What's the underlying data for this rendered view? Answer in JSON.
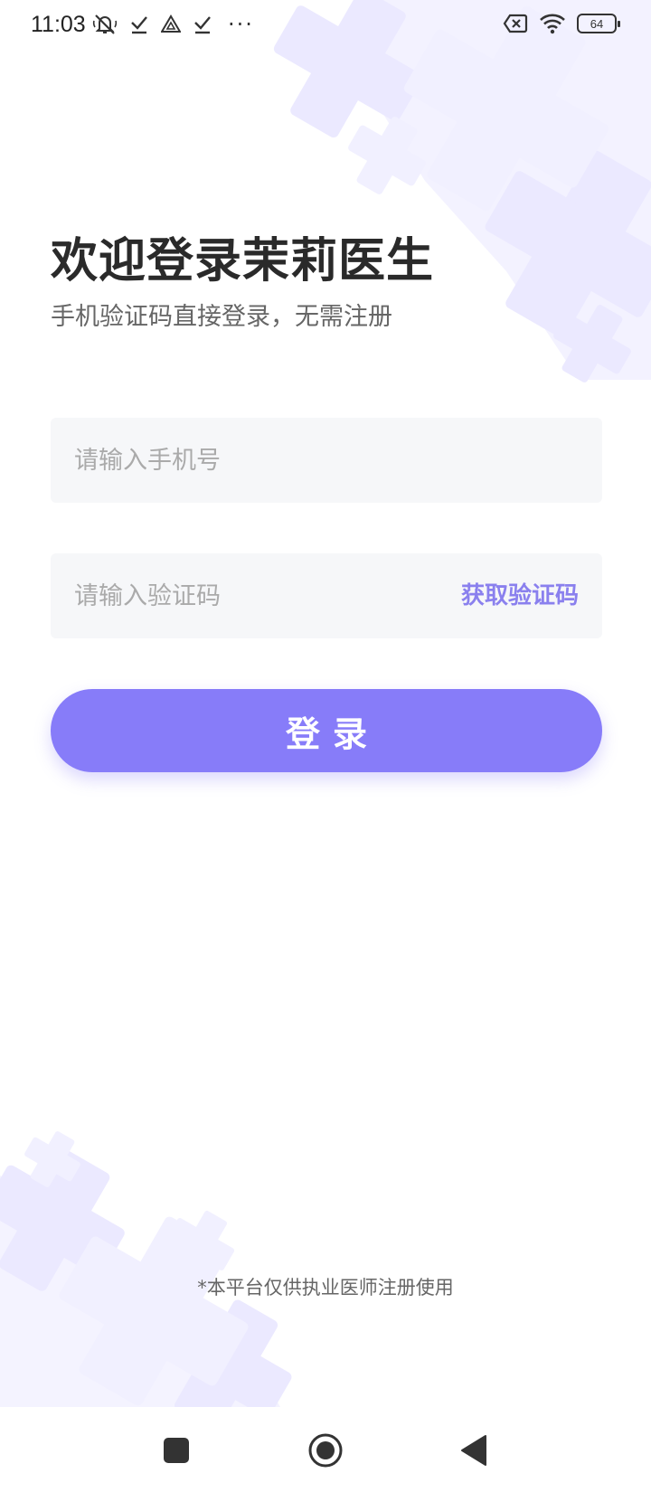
{
  "status_bar": {
    "time": "11:03",
    "more": "···",
    "battery": "64"
  },
  "login": {
    "title": "欢迎登录茉莉医生",
    "subtitle": "手机验证码直接登录，无需注册",
    "phone_placeholder": "请输入手机号",
    "code_placeholder": "请输入验证码",
    "get_code_label": "获取验证码",
    "login_label": "登录"
  },
  "footer": {
    "note": "*本平台仅供执业医师注册使用"
  },
  "colors": {
    "accent": "#877cf9",
    "link": "#8a80ee",
    "input_bg": "#f6f7f9",
    "deco": "#eeedff"
  },
  "icons": {
    "status_left": [
      "mute-icon",
      "check-icon",
      "drive-icon",
      "check-icon"
    ],
    "status_right": [
      "no-sim-icon",
      "wifi-icon",
      "battery-icon"
    ],
    "nav": [
      "recents-icon",
      "home-icon",
      "back-icon"
    ]
  }
}
